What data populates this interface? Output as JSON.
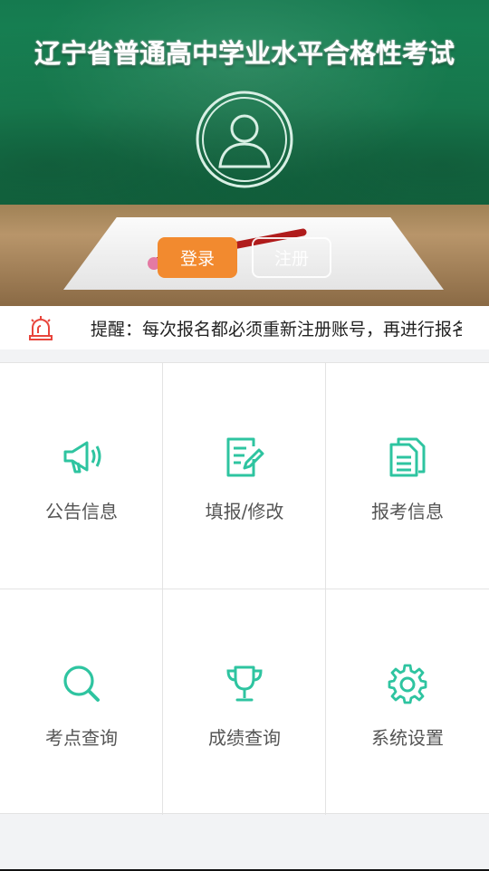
{
  "header": {
    "title": "辽宁省普通高中学业水平合格性考试",
    "login_label": "登录",
    "register_label": "注册"
  },
  "notice": {
    "icon": "alarm-icon",
    "text": "提醒：每次报名都必须重新注册账号，再进行报名"
  },
  "menu": {
    "items": [
      {
        "label": "公告信息",
        "icon": "megaphone-icon"
      },
      {
        "label": "填报/修改",
        "icon": "edit-form-icon"
      },
      {
        "label": "报考信息",
        "icon": "documents-icon"
      },
      {
        "label": "考点查询",
        "icon": "search-icon"
      },
      {
        "label": "成绩查询",
        "icon": "trophy-icon"
      },
      {
        "label": "系统设置",
        "icon": "gear-icon"
      }
    ]
  },
  "colors": {
    "accent": "#2ec4a0",
    "login_button": "#f28a2f",
    "alarm": "#e8453c"
  }
}
